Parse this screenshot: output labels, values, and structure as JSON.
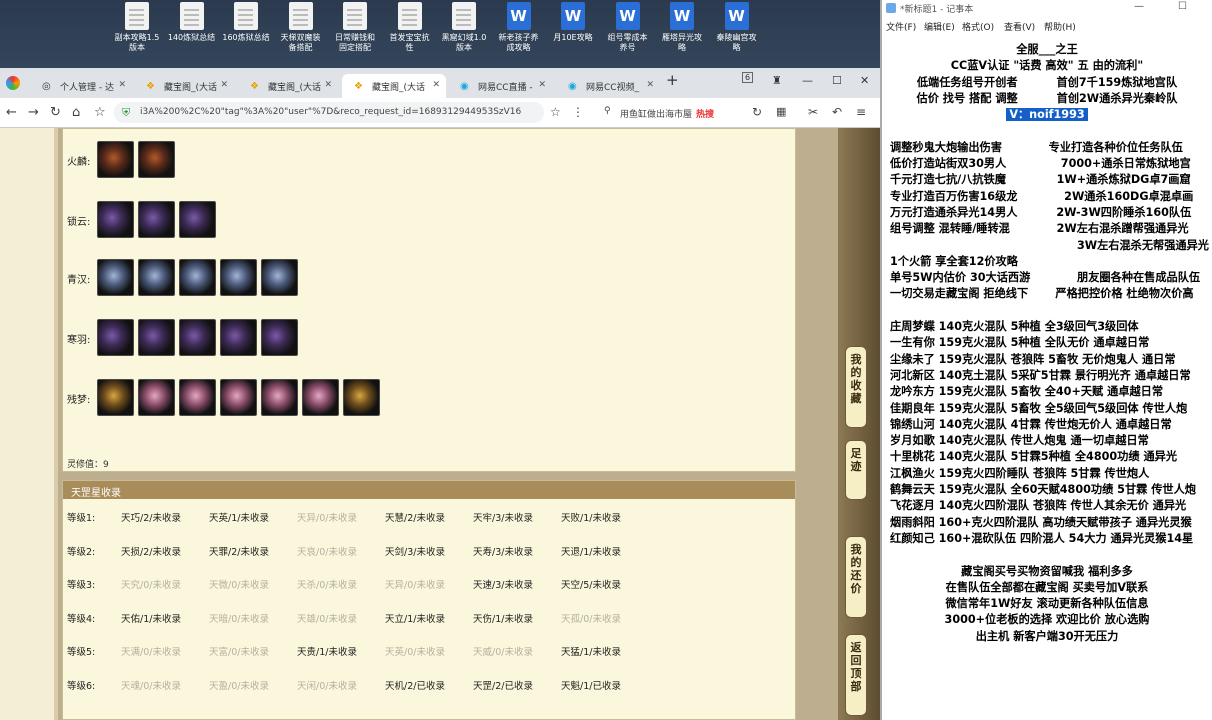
{
  "desktop": {
    "icons": [
      {
        "label": "副本攻略1.5\n版本",
        "type": "doc"
      },
      {
        "label": "140炼狱总结",
        "type": "doc"
      },
      {
        "label": "160炼狱总结",
        "type": "doc"
      },
      {
        "label": "天梯双魔装\n备搭配",
        "type": "doc"
      },
      {
        "label": "日常赚钱和\n固定搭配",
        "type": "doc"
      },
      {
        "label": "首发宝宝抗\n性",
        "type": "doc"
      },
      {
        "label": "黑窟幻域1.0\n版本",
        "type": "doc"
      },
      {
        "label": "新老孩子养\n成攻略",
        "type": "word"
      },
      {
        "label": "月10E攻略",
        "type": "word"
      },
      {
        "label": "组号零成本\n养号",
        "type": "word"
      },
      {
        "label": "雁塔异光攻\n略",
        "type": "word"
      },
      {
        "label": "秦陵幽宫攻\n略",
        "type": "word"
      }
    ]
  },
  "browser": {
    "tabs": [
      "个人管理 - 达",
      "藏宝阁_(大话",
      "藏宝阁_(大话",
      "藏宝阁_(大话",
      "网易CC直播 -",
      "网易CC视频_"
    ],
    "tab_count": "6",
    "url": "i3A%200%2C%20\"tag\"%3A%20\"user\"%7D&reco_request_id=1689312944953SzV16",
    "search_text": "用鱼缸做出海市蜃",
    "hot_label": "热搜"
  },
  "page": {
    "slot_rows": [
      {
        "label": "火麟:",
        "count": 2,
        "style": "fire"
      },
      {
        "label": "锁云:",
        "count": 3,
        "style": "purple"
      },
      {
        "label": "青汉:",
        "count": 5,
        "style": "steel"
      },
      {
        "label": "寒羽:",
        "count": 5,
        "style": "purple"
      },
      {
        "label": "残梦:",
        "count": 7,
        "style": "pink"
      }
    ],
    "lingxiu": "灵修值：9",
    "section_title": "天罡星收录",
    "levels": [
      {
        "label": "等级1:",
        "cells": [
          {
            "t": "天巧/2/未收录",
            "dim": false
          },
          {
            "t": "天英/1/未收录",
            "dim": false
          },
          {
            "t": "天异/0/未收录",
            "dim": true
          },
          {
            "t": "天慧/2/未收录",
            "dim": false
          },
          {
            "t": "天牢/3/未收录",
            "dim": false
          },
          {
            "t": "天败/1/未收录",
            "dim": false
          }
        ]
      },
      {
        "label": "等级2:",
        "cells": [
          {
            "t": "天损/2/未收录",
            "dim": false
          },
          {
            "t": "天罪/2/未收录",
            "dim": false
          },
          {
            "t": "天哀/0/未收录",
            "dim": true
          },
          {
            "t": "天剑/3/未收录",
            "dim": false
          },
          {
            "t": "天寿/3/未收录",
            "dim": false
          },
          {
            "t": "天退/1/未收录",
            "dim": false
          }
        ]
      },
      {
        "label": "等级3:",
        "cells": [
          {
            "t": "天究/0/未收录",
            "dim": true
          },
          {
            "t": "天微/0/未收录",
            "dim": true
          },
          {
            "t": "天杀/0/未收录",
            "dim": true
          },
          {
            "t": "天异/0/未收录",
            "dim": true
          },
          {
            "t": "天速/3/未收录",
            "dim": false
          },
          {
            "t": "天空/5/未收录",
            "dim": false
          }
        ]
      },
      {
        "label": "等级4:",
        "cells": [
          {
            "t": "天佑/1/未收录",
            "dim": false
          },
          {
            "t": "天暗/0/未收录",
            "dim": true
          },
          {
            "t": "天雄/0/未收录",
            "dim": true
          },
          {
            "t": "天立/1/未收录",
            "dim": false
          },
          {
            "t": "天伤/1/未收录",
            "dim": false
          },
          {
            "t": "天孤/0/未收录",
            "dim": true
          }
        ]
      },
      {
        "label": "等级5:",
        "cells": [
          {
            "t": "天满/0/未收录",
            "dim": true
          },
          {
            "t": "天富/0/未收录",
            "dim": true
          },
          {
            "t": "天贵/1/未收录",
            "dim": false
          },
          {
            "t": "天英/0/未收录",
            "dim": true
          },
          {
            "t": "天威/0/未收录",
            "dim": true
          },
          {
            "t": "天猛/1/未收录",
            "dim": false
          }
        ]
      },
      {
        "label": "等级6:",
        "cells": [
          {
            "t": "天魂/0/未收录",
            "dim": true
          },
          {
            "t": "天盈/0/未收录",
            "dim": true
          },
          {
            "t": "天闲/0/未收录",
            "dim": true
          },
          {
            "t": "天机/2/已收录",
            "dim": false
          },
          {
            "t": "天罡/2/已收录",
            "dim": false
          },
          {
            "t": "天魁/1/已收录",
            "dim": false
          }
        ]
      }
    ],
    "side_tabs": [
      "我的收藏",
      "足迹",
      "我的还价",
      "返回顶部"
    ]
  },
  "notepad": {
    "title": "*新标题1 - 记事本",
    "menu": [
      "文件(F)",
      "编辑(E)",
      "格式(O)",
      "查看(V)",
      "帮助(H)"
    ],
    "lines": [
      {
        "t": "全服___之王",
        "a": "c"
      },
      {
        "t": "CC蓝V认证 \"话费 高效\" 五 由的流利\"",
        "a": "c"
      },
      {
        "t": "低端任务组号开创者          首创7千159炼狱地宫队",
        "a": "c"
      },
      {
        "t": "估价 找号 搭配 调整          首创2W通杀异光秦岭队",
        "a": "c"
      },
      {
        "t": "V：noif1993",
        "a": "c",
        "hl": true
      },
      {
        "t": "",
        "a": "l"
      },
      {
        "t": "调整秒鬼大炮输出伤害            专业打造各种价位任务队伍",
        "a": "l"
      },
      {
        "t": "低价打造站街双30男人              7000+通杀日常炼狱地宫",
        "a": "l"
      },
      {
        "t": "千元打造七抗/八抗铁魔             1W+通杀炼狱DG卓7画窟",
        "a": "l"
      },
      {
        "t": "专业打造百万伤害16级龙            2W通杀160DG卓混卓画",
        "a": "l"
      },
      {
        "t": "万元打造通杀异光14男人          2W-3W四阶睡杀160队伍",
        "a": "l"
      },
      {
        "t": "组号调整 混转睡/睡转混            2W左右混杀蹭帮强通异光",
        "a": "l"
      },
      {
        "t": "                                                3W左右混杀无帮强通异光",
        "a": "l"
      },
      {
        "t": "1个火箭 享全套12价攻略",
        "a": "l"
      },
      {
        "t": "单号5W内估价 30大话西游            朋友圈各种在售成品队伍",
        "a": "l"
      },
      {
        "t": "一切交易走藏宝阁 拒绝线下       严格把控价格 杜绝物次价高",
        "a": "l"
      },
      {
        "t": "",
        "a": "l"
      },
      {
        "t": "庄周梦蝶 140克火混队 5种植 全3级回气3级回体",
        "a": "l"
      },
      {
        "t": "一生有你 159克火混队 5种植 全队无价 通卓越日常",
        "a": "l"
      },
      {
        "t": "尘缘未了 159克火混队 苍狼阵 5畜牧 无价炮鬼人 通日常",
        "a": "l"
      },
      {
        "t": "河北新区 140克土混队 5采矿5甘霖 景行明光齐 通卓越日常",
        "a": "l"
      },
      {
        "t": "龙吟东方 159克火混队 5畜牧 全40+天赋 通卓越日常",
        "a": "l"
      },
      {
        "t": "佳期良年 159克火混队 5畜牧 全5级回气5级回体 传世人炮",
        "a": "l"
      },
      {
        "t": "锦绣山河 140克火混队 4甘霖 传世炮无价人 通卓越日常",
        "a": "l"
      },
      {
        "t": "岁月如歌 140克火混队 传世人炮鬼 通一切卓越日常",
        "a": "l"
      },
      {
        "t": "十里桃花 140克火混队 5甘霖5种植 全4800功绩 通异光",
        "a": "l"
      },
      {
        "t": "江枫渔火 159克火四阶睡队 苍狼阵 5甘霖 传世炮人",
        "a": "l"
      },
      {
        "t": "鹤舞云天 159克火混队 全60天赋4800功绩 5甘霖 传世人炮",
        "a": "l"
      },
      {
        "t": "飞花逐月 140克火四阶混队 苍狼阵 传世人其余无价 通异光",
        "a": "l"
      },
      {
        "t": "烟雨斜阳 160+克火四阶混队 高功绩天赋带孩子 通异光灵猴",
        "a": "l"
      },
      {
        "t": "红颜知己 160+混砍队伍 四阶混人 54大力 通异光灵猴14星",
        "a": "l"
      },
      {
        "t": "",
        "a": "l"
      },
      {
        "t": "藏宝阁买号买物资留喊我 福利多多",
        "a": "c"
      },
      {
        "t": "在售队伍全部都在藏宝阁 买卖号加V联系",
        "a": "c"
      },
      {
        "t": "微信常年1W好友 滚动更新各种队伍信息",
        "a": "c"
      },
      {
        "t": "3000+位老板的选择 欢迎比价 放心选购",
        "a": "c"
      },
      {
        "t": "出主机 新客户端30开无压力",
        "a": "c"
      }
    ]
  }
}
